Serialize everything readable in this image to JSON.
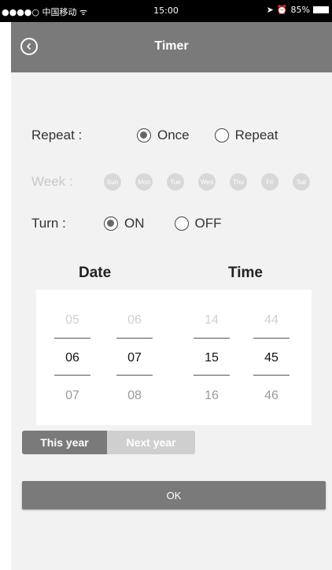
{
  "status_bar": {
    "carrier": "●●●●○ 中国移动 ᯤ",
    "time": "15:00",
    "battery": "85%"
  },
  "header": {
    "title": "Timer"
  },
  "repeat": {
    "label": "Repeat :",
    "options": [
      "Once",
      "Repeat"
    ],
    "selected": "Once"
  },
  "week": {
    "label": "Week :",
    "days": [
      "Sun",
      "Mon",
      "Tue",
      "Wed",
      "Thu",
      "Fri",
      "Sat"
    ]
  },
  "turn": {
    "label": "Turn :",
    "options": [
      "ON",
      "OFF"
    ],
    "selected": "ON"
  },
  "picker": {
    "date_title": "Date",
    "time_title": "Time",
    "columns": [
      {
        "prev": "05",
        "current": "06",
        "next": "07"
      },
      {
        "prev": "06",
        "current": "07",
        "next": "08"
      },
      {
        "prev": "14",
        "current": "15",
        "next": "16"
      },
      {
        "prev": "44",
        "current": "45",
        "next": "46"
      }
    ]
  },
  "year_toggle": {
    "this_year": "This year",
    "next_year": "Next year",
    "selected": "This year"
  },
  "ok_label": "OK",
  "colors": {
    "header_bg": "#7a7a7a",
    "content_bg": "#f2f2f2",
    "inactive": "#cfcfcf"
  }
}
